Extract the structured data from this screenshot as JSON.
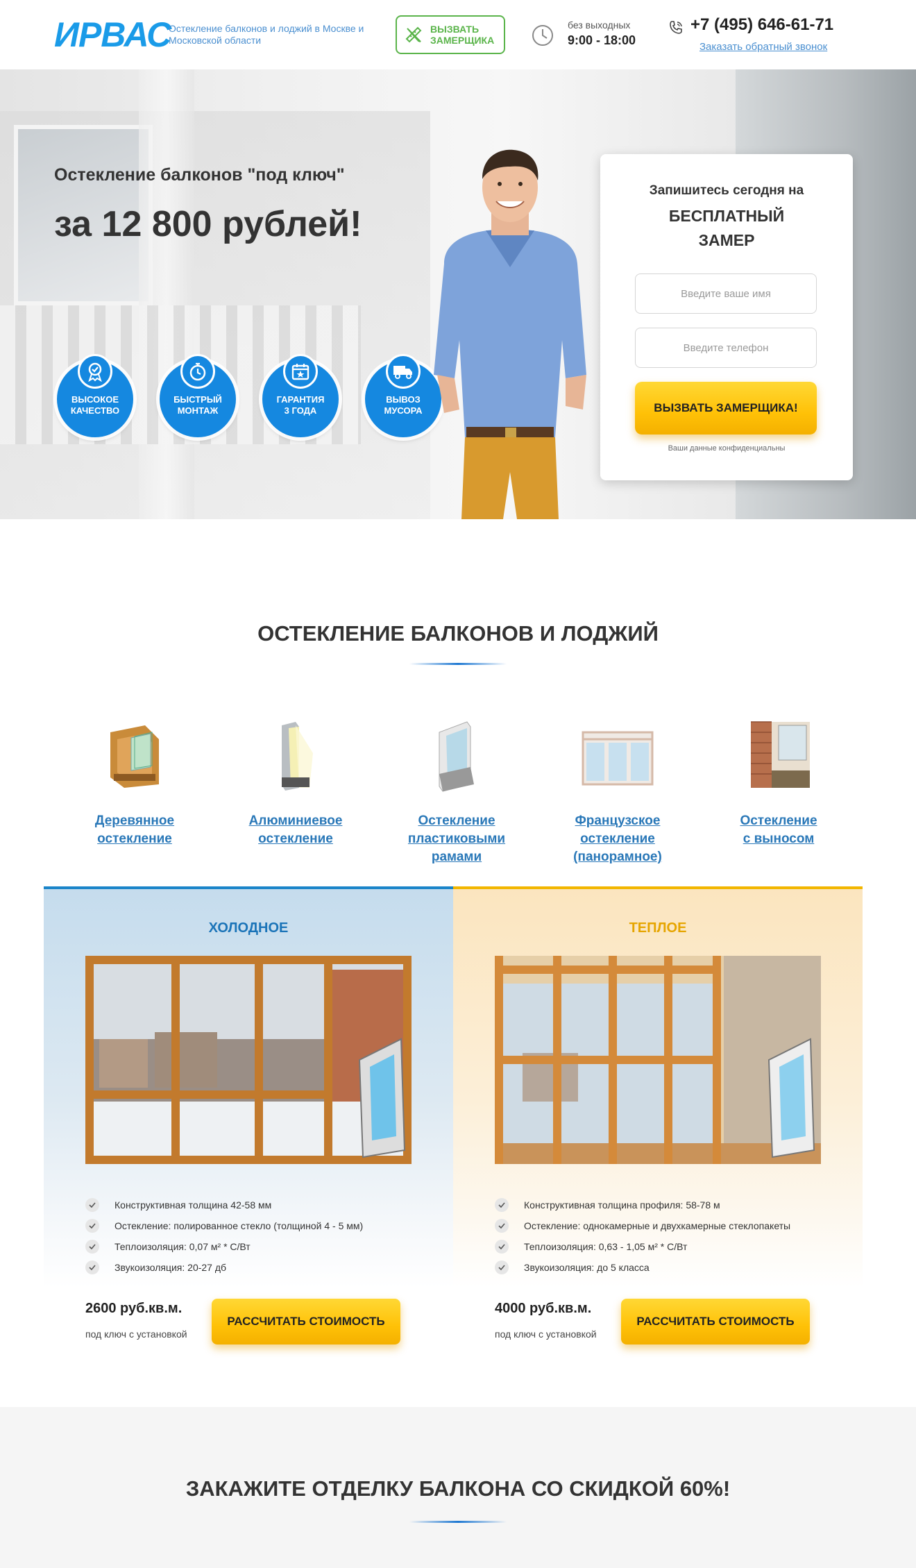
{
  "header": {
    "logo": "ИРВАС",
    "tagline": "Остекление балконов и лоджий в Москве и Московской области",
    "call_button": "ВЫЗВАТЬ\nЗАМЕРЩИКА",
    "hours_label": "без выходных",
    "hours_value": "9:00 - 18:00",
    "phone": "+7 (495) 646-61-71",
    "callback_link": "Заказать обратный звонок"
  },
  "hero": {
    "subtitle": "Остекление балконов \"под ключ\"",
    "price": "за 12 800 рублей!",
    "badges": [
      {
        "label": "ВЫСОКОЕ\nКАЧЕСТВО",
        "icon": "medal-icon"
      },
      {
        "label": "БЫСТРЫЙ\nМОНТАЖ",
        "icon": "stopwatch-icon"
      },
      {
        "label": "ГАРАНТИЯ\n3 ГОДА",
        "icon": "calendar-star-icon"
      },
      {
        "label": "ВЫВОЗ\nМУСОРА",
        "icon": "truck-icon"
      }
    ]
  },
  "form": {
    "title_line1": "Запишитесь сегодня на",
    "title_line2": "БЕСПЛАТНЫЙ\nЗАМЕР",
    "name_placeholder": "Введите ваше имя",
    "phone_placeholder": "Введите телефон",
    "submit": "ВЫЗВАТЬ ЗАМЕРЩИКА!",
    "note": "Ваши данные конфиденциальны"
  },
  "glazing": {
    "title": "ОСТЕКЛЕНИЕ БАЛКОНОВ И ЛОДЖИЙ",
    "categories": [
      {
        "label": "Деревянное\nостекление",
        "icon": "wooden-frame-icon"
      },
      {
        "label": "Алюминиевое\nостекление",
        "icon": "aluminum-frame-icon"
      },
      {
        "label": "Остекление\nпластиковыми\nрамами",
        "icon": "plastic-frame-icon"
      },
      {
        "label": "Французское\nостекление\n(панорамное)",
        "icon": "panoramic-frame-icon"
      },
      {
        "label": "Остекление\nс выносом",
        "icon": "extended-balcony-icon"
      }
    ]
  },
  "compare": {
    "cold": {
      "title": "ХОЛОДНОЕ",
      "features": [
        "Конструктивная толщина 42-58 мм",
        "Остекление: полированное стекло (толщиной 4 - 5 мм)",
        "Теплоизоляция: 0,07 м² * С/Вт",
        "Звукоизоляция: 20-27 дб"
      ],
      "price": "2600 руб.кв.м.",
      "price_note": "под ключ с установкой",
      "button": "РАССЧИТАТЬ СТОИМОСТЬ"
    },
    "warm": {
      "title": "ТЕПЛОЕ",
      "features": [
        "Конструктивная толщина профиля: 58-78 м",
        "Остекление: однокамерные и двухкамерные стеклопакеты",
        "Теплоизоляция: 0,63 - 1,05 м² * С/Вт",
        "Звукоизоляция: до 5 класса"
      ],
      "price": "4000 руб.кв.м.",
      "price_note": "под ключ с установкой",
      "button": "РАССЧИТАТЬ СТОИМОСТЬ"
    }
  },
  "promo": {
    "title": "ЗАКАЖИТЕ ОТДЕЛКУ БАЛКОНА СО СКИДКОЙ 60%!"
  },
  "colors": {
    "brand_blue": "#1a9be8",
    "accent_green": "#5ab44a",
    "button_yellow": "#ffc107",
    "cold_accent": "#1b85c9",
    "warm_accent": "#f2b600"
  }
}
